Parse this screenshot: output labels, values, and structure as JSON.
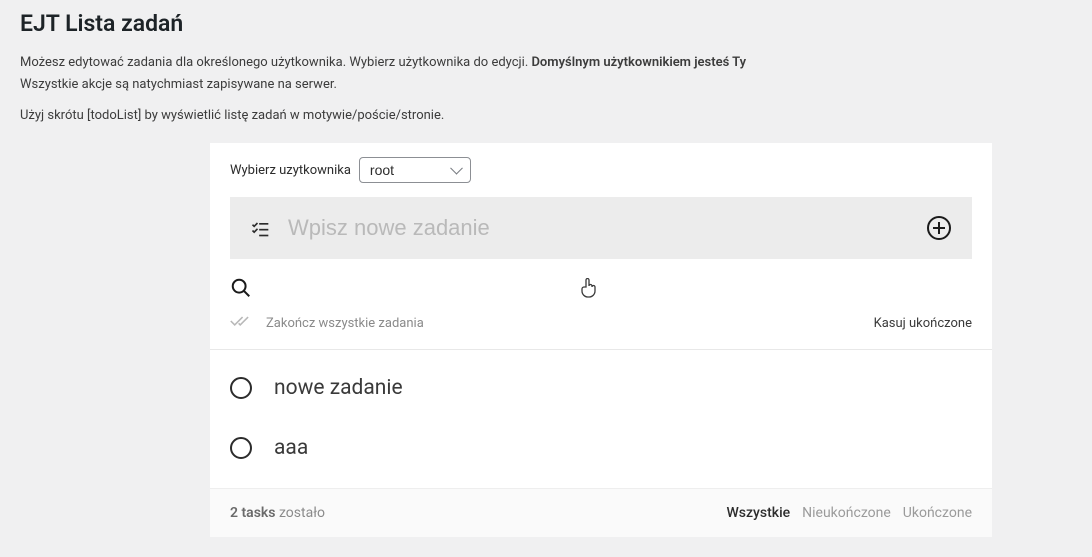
{
  "page": {
    "title": "EJT Lista zadań",
    "intro_line1": "Możesz edytować zadania dla określonego użytkownika. Wybierz użytkownika do edycji. ",
    "intro_bold": "Domyślnym użytkownikiem jesteś Ty",
    "intro_line2": "Wszystkie akcje są natychmiast zapisywane na serwer.",
    "shortcode_hint": "Użyj skrótu [todoList] by wyświetlić listę zadań w motywie/poście/stronie."
  },
  "user_select": {
    "label": "Wybierz uzytkownika",
    "selected": "root"
  },
  "new_task": {
    "placeholder": "Wpisz nowe zadanie"
  },
  "bulk": {
    "complete_all": "Zakończ wszystkie zadania",
    "clear_completed": "Kasuj ukończone"
  },
  "tasks": [
    {
      "label": "nowe zadanie"
    },
    {
      "label": "aaa"
    }
  ],
  "footer": {
    "count": "2 tasks",
    "remaining": " zostało",
    "filters": {
      "all": "Wszystkie",
      "active": "Nieukończone",
      "completed": "Ukończone"
    }
  }
}
